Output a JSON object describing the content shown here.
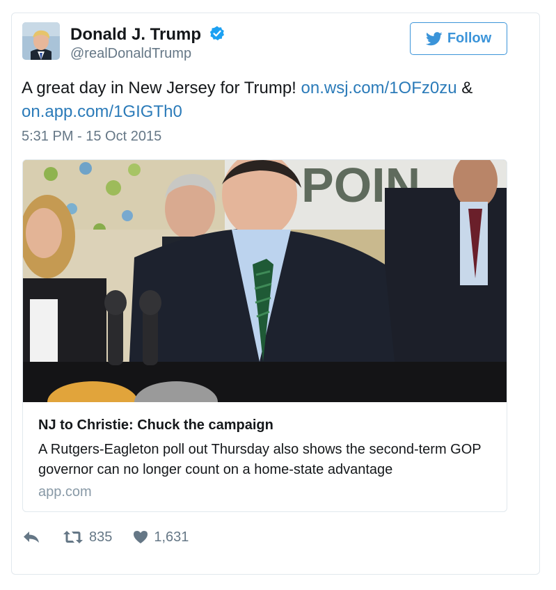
{
  "author": {
    "name": "Donald J. Trump",
    "handle": "@realDonaldTrump",
    "verified": true
  },
  "follow_button": {
    "label": "Follow",
    "color": "#3b94d9"
  },
  "tweet": {
    "text_before": "A great day in New Jersey for Trump! ",
    "link1": "on.wsj.com/1OFz0zu",
    "text_between": " & ",
    "link2": "on.app.com/1GIGTh0",
    "timestamp": "5:31 PM - 15 Oct 2015"
  },
  "card": {
    "sign_text": "POIN",
    "title": "NJ to Christie: Chuck the campaign",
    "description": "A Rutgers-Eagleton poll out Thursday also shows the second-term GOP governor can no longer count on a home-state advantage",
    "domain": "app.com"
  },
  "actions": {
    "reply_icon": "reply-icon",
    "retweet_icon": "retweet-icon",
    "retweets": "835",
    "like_icon": "heart-icon",
    "likes": "1,631"
  },
  "colors": {
    "link": "#2b7bb9",
    "muted": "#657786",
    "border": "#e1e8ed"
  }
}
